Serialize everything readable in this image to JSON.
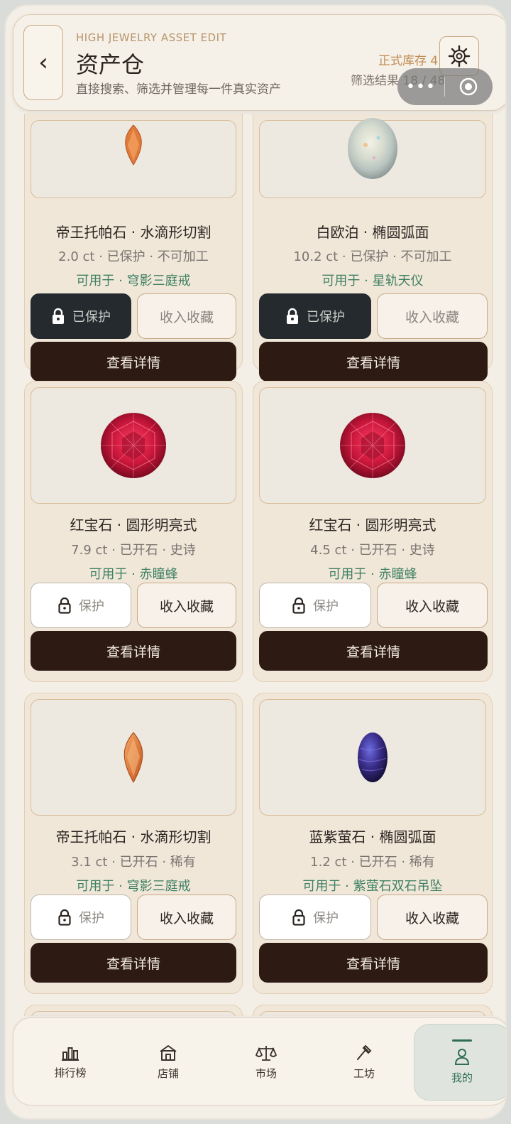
{
  "header": {
    "back_icon": "chevron-left-icon",
    "eyebrow": "HIGH JEWELRY ASSET EDIT",
    "title": "资产仓",
    "subtitle": "直接搜索、筛选并管理每一件真实资产",
    "stock_text": "正式库存 4",
    "filter_text": "筛选结果 18 / 48",
    "settings_icon": "gear-icon",
    "capsule_more": "•••",
    "capsule_icon": "target-icon"
  },
  "cards": [
    {
      "name": "帝王托帕石 · 水滴形切割",
      "meta": "2.0 ct · 已保护 · 不可加工",
      "usage": "可用于 · 穹影三庭戒",
      "protect_label": "已保护",
      "protect_state": "on",
      "collect_label": "收入收藏",
      "detail_label": "查看详情",
      "gem": "topaz-marquise",
      "gem_color": "#e07a3a"
    },
    {
      "name": "白欧泊 · 椭圆弧面",
      "meta": "10.2 ct · 已保护 · 不可加工",
      "usage": "可用于 · 星轨天仪",
      "protect_label": "已保护",
      "protect_state": "on",
      "collect_label": "收入收藏",
      "detail_label": "查看详情",
      "gem": "opal-oval",
      "gem_color": "#cfd6cc"
    },
    {
      "name": "红宝石 · 圆形明亮式",
      "meta": "7.9 ct · 已开石 · 史诗",
      "usage": "可用于 · 赤瞳蜂",
      "protect_label": "保护",
      "protect_state": "off",
      "collect_label": "收入收藏",
      "detail_label": "查看详情",
      "gem": "ruby-round",
      "gem_color": "#c8163a"
    },
    {
      "name": "红宝石 · 圆形明亮式",
      "meta": "4.5 ct · 已开石 · 史诗",
      "usage": "可用于 · 赤瞳蜂",
      "protect_label": "保护",
      "protect_state": "off",
      "collect_label": "收入收藏",
      "detail_label": "查看详情",
      "gem": "ruby-round",
      "gem_color": "#c8163a"
    },
    {
      "name": "帝王托帕石 · 水滴形切割",
      "meta": "3.1 ct · 已开石 · 稀有",
      "usage": "可用于 · 穹影三庭戒",
      "protect_label": "保护",
      "protect_state": "off",
      "collect_label": "收入收藏",
      "detail_label": "查看详情",
      "gem": "topaz-marquise",
      "gem_color": "#e07a3a"
    },
    {
      "name": "蓝紫萤石 · 椭圆弧面",
      "meta": "1.2 ct · 已开石 · 稀有",
      "usage": "可用于 · 紫萤石双石吊坠",
      "protect_label": "保护",
      "protect_state": "off",
      "collect_label": "收入收藏",
      "detail_label": "查看详情",
      "gem": "fluorite-oval",
      "gem_color": "#3a2d8a"
    }
  ],
  "nav": [
    {
      "label": "排行榜",
      "icon": "bar-chart-icon"
    },
    {
      "label": "店铺",
      "icon": "store-icon"
    },
    {
      "label": "市场",
      "icon": "scale-icon"
    },
    {
      "label": "工坊",
      "icon": "hammer-icon"
    },
    {
      "label": "我的",
      "icon": "user-icon",
      "active": true
    }
  ],
  "colors": {
    "accent_green": "#2f6e55",
    "dark_button": "#2d1a13",
    "gold_border": "#c9a883"
  }
}
